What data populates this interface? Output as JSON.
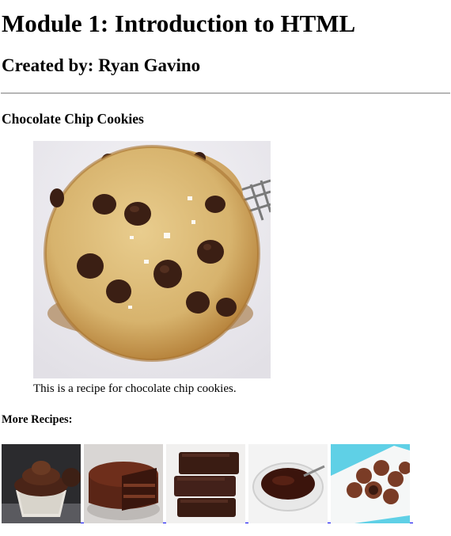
{
  "page": {
    "heading": "Module 1: Introduction to HTML",
    "author_line": "Created by: Ryan Gavino"
  },
  "recipe": {
    "title": "Chocolate Chip Cookies",
    "image_alt": "Chocolate chip cookie",
    "caption": "This is a recipe for chocolate chip cookies."
  },
  "more_recipes": {
    "heading": "More Recipes:",
    "items": [
      {
        "icon": "cupcake-image",
        "alt": "Chocolate cupcakes"
      },
      {
        "icon": "chocolate-cake-image",
        "alt": "Chocolate cake"
      },
      {
        "icon": "brownies-image",
        "alt": "Brownies"
      },
      {
        "icon": "chocolate-sauce-image",
        "alt": "Chocolate sauce in a bowl"
      },
      {
        "icon": "truffles-image",
        "alt": "Chocolate truffles"
      }
    ]
  },
  "colors": {
    "text": "#000000",
    "link_underline": "#0000ee",
    "cookie_dough": "#d9b877",
    "chocolate": "#3b1f14",
    "background": "#ffffff"
  }
}
